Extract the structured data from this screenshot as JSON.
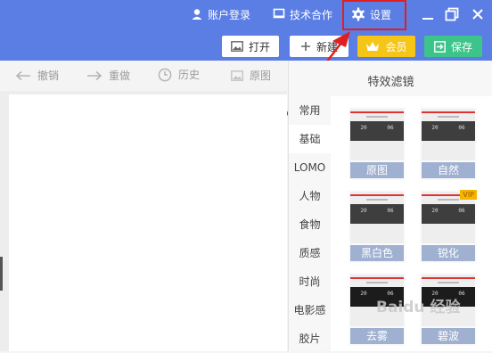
{
  "titlebar": {
    "login": "账户登录",
    "tech": "技术合作",
    "settings": "设置"
  },
  "actions": {
    "open": "打开",
    "new": "新建",
    "vip": "会员",
    "save": "保存"
  },
  "toolbar": {
    "undo": "撤销",
    "redo": "重做",
    "history": "历史",
    "original": "原图"
  },
  "panel": {
    "title": "特效滤镜",
    "categories": [
      "常用",
      "基础",
      "LOMO",
      "人物",
      "食物",
      "质感",
      "时尚",
      "电影感",
      "胶片"
    ],
    "active_category": "基础",
    "filters": [
      {
        "label": "原图",
        "dark": false,
        "vip": false
      },
      {
        "label": "自然",
        "dark": false,
        "vip": false
      },
      {
        "label": "黑白色",
        "dark": false,
        "vip": false
      },
      {
        "label": "锐化",
        "dark": false,
        "vip": true
      },
      {
        "label": "去雾",
        "dark": true,
        "vip": false
      },
      {
        "label": "碧波",
        "dark": true,
        "vip": false
      }
    ],
    "vip_badge": "VIP",
    "thumb_numbers": [
      "20",
      "06"
    ]
  },
  "watermark": "Baidu 经验",
  "colors": {
    "titlebar": "#5b7ee5",
    "vip_button": "#f5c518",
    "save_button": "#3cc48a",
    "highlight": "#e02020"
  }
}
